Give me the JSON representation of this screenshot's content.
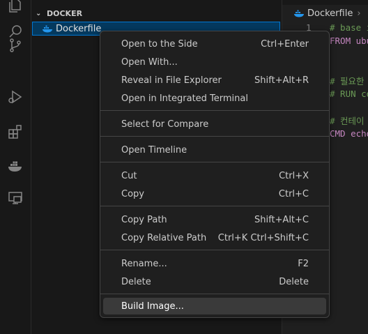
{
  "activity_bar": {
    "icons": [
      "explorer-icon",
      "search-icon",
      "source-control-icon",
      "run-debug-icon",
      "extensions-icon",
      "docker-icon",
      "remote-explorer-icon"
    ]
  },
  "sidebar": {
    "section_title": "DOCKER",
    "selected_file": "Dockerfile"
  },
  "editor": {
    "tab_label": "Dockerfile",
    "lines": [
      {
        "num": "1",
        "text": "# base i"
      },
      {
        "num": "",
        "text": "FROM ubu"
      },
      {
        "num": "",
        "text": ""
      },
      {
        "num": "",
        "text": "# 필요한"
      },
      {
        "num": "",
        "text": "# RUN co"
      },
      {
        "num": "",
        "text": ""
      },
      {
        "num": "",
        "text": "# 컨테이"
      },
      {
        "num": "",
        "text": "CMD echo"
      }
    ]
  },
  "context_menu": {
    "items": [
      {
        "label": "Open to the Side",
        "shortcut": "Ctrl+Enter"
      },
      {
        "label": "Open With...",
        "shortcut": ""
      },
      {
        "label": "Reveal in File Explorer",
        "shortcut": "Shift+Alt+R"
      },
      {
        "label": "Open in Integrated Terminal",
        "shortcut": ""
      },
      {
        "label": "Select for Compare",
        "shortcut": ""
      },
      {
        "label": "Open Timeline",
        "shortcut": ""
      },
      {
        "label": "Cut",
        "shortcut": "Ctrl+X"
      },
      {
        "label": "Copy",
        "shortcut": "Ctrl+C"
      },
      {
        "label": "Copy Path",
        "shortcut": "Shift+Alt+C"
      },
      {
        "label": "Copy Relative Path",
        "shortcut": "Ctrl+K Ctrl+Shift+C"
      },
      {
        "label": "Rename...",
        "shortcut": "F2"
      },
      {
        "label": "Delete",
        "shortcut": "Delete"
      },
      {
        "label": "Build Image...",
        "shortcut": ""
      }
    ]
  },
  "colors": {
    "accent": "#0078d4",
    "selection": "#04395e",
    "menu_bg": "#1f1f1f",
    "hover": "#3a3a3a",
    "docker_blue": "#2496ed"
  }
}
